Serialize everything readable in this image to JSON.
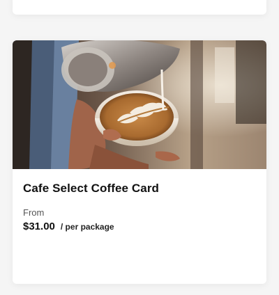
{
  "product": {
    "title": "Cafe Select Coffee Card",
    "from_label": "From",
    "price": "$31.00",
    "unit": "/ per package",
    "image_subject": "latte-art-pour"
  },
  "colors": {
    "page_background": "#f5f5f5",
    "card_background": "#ffffff",
    "text_primary": "#111111",
    "text_secondary": "#555555"
  }
}
